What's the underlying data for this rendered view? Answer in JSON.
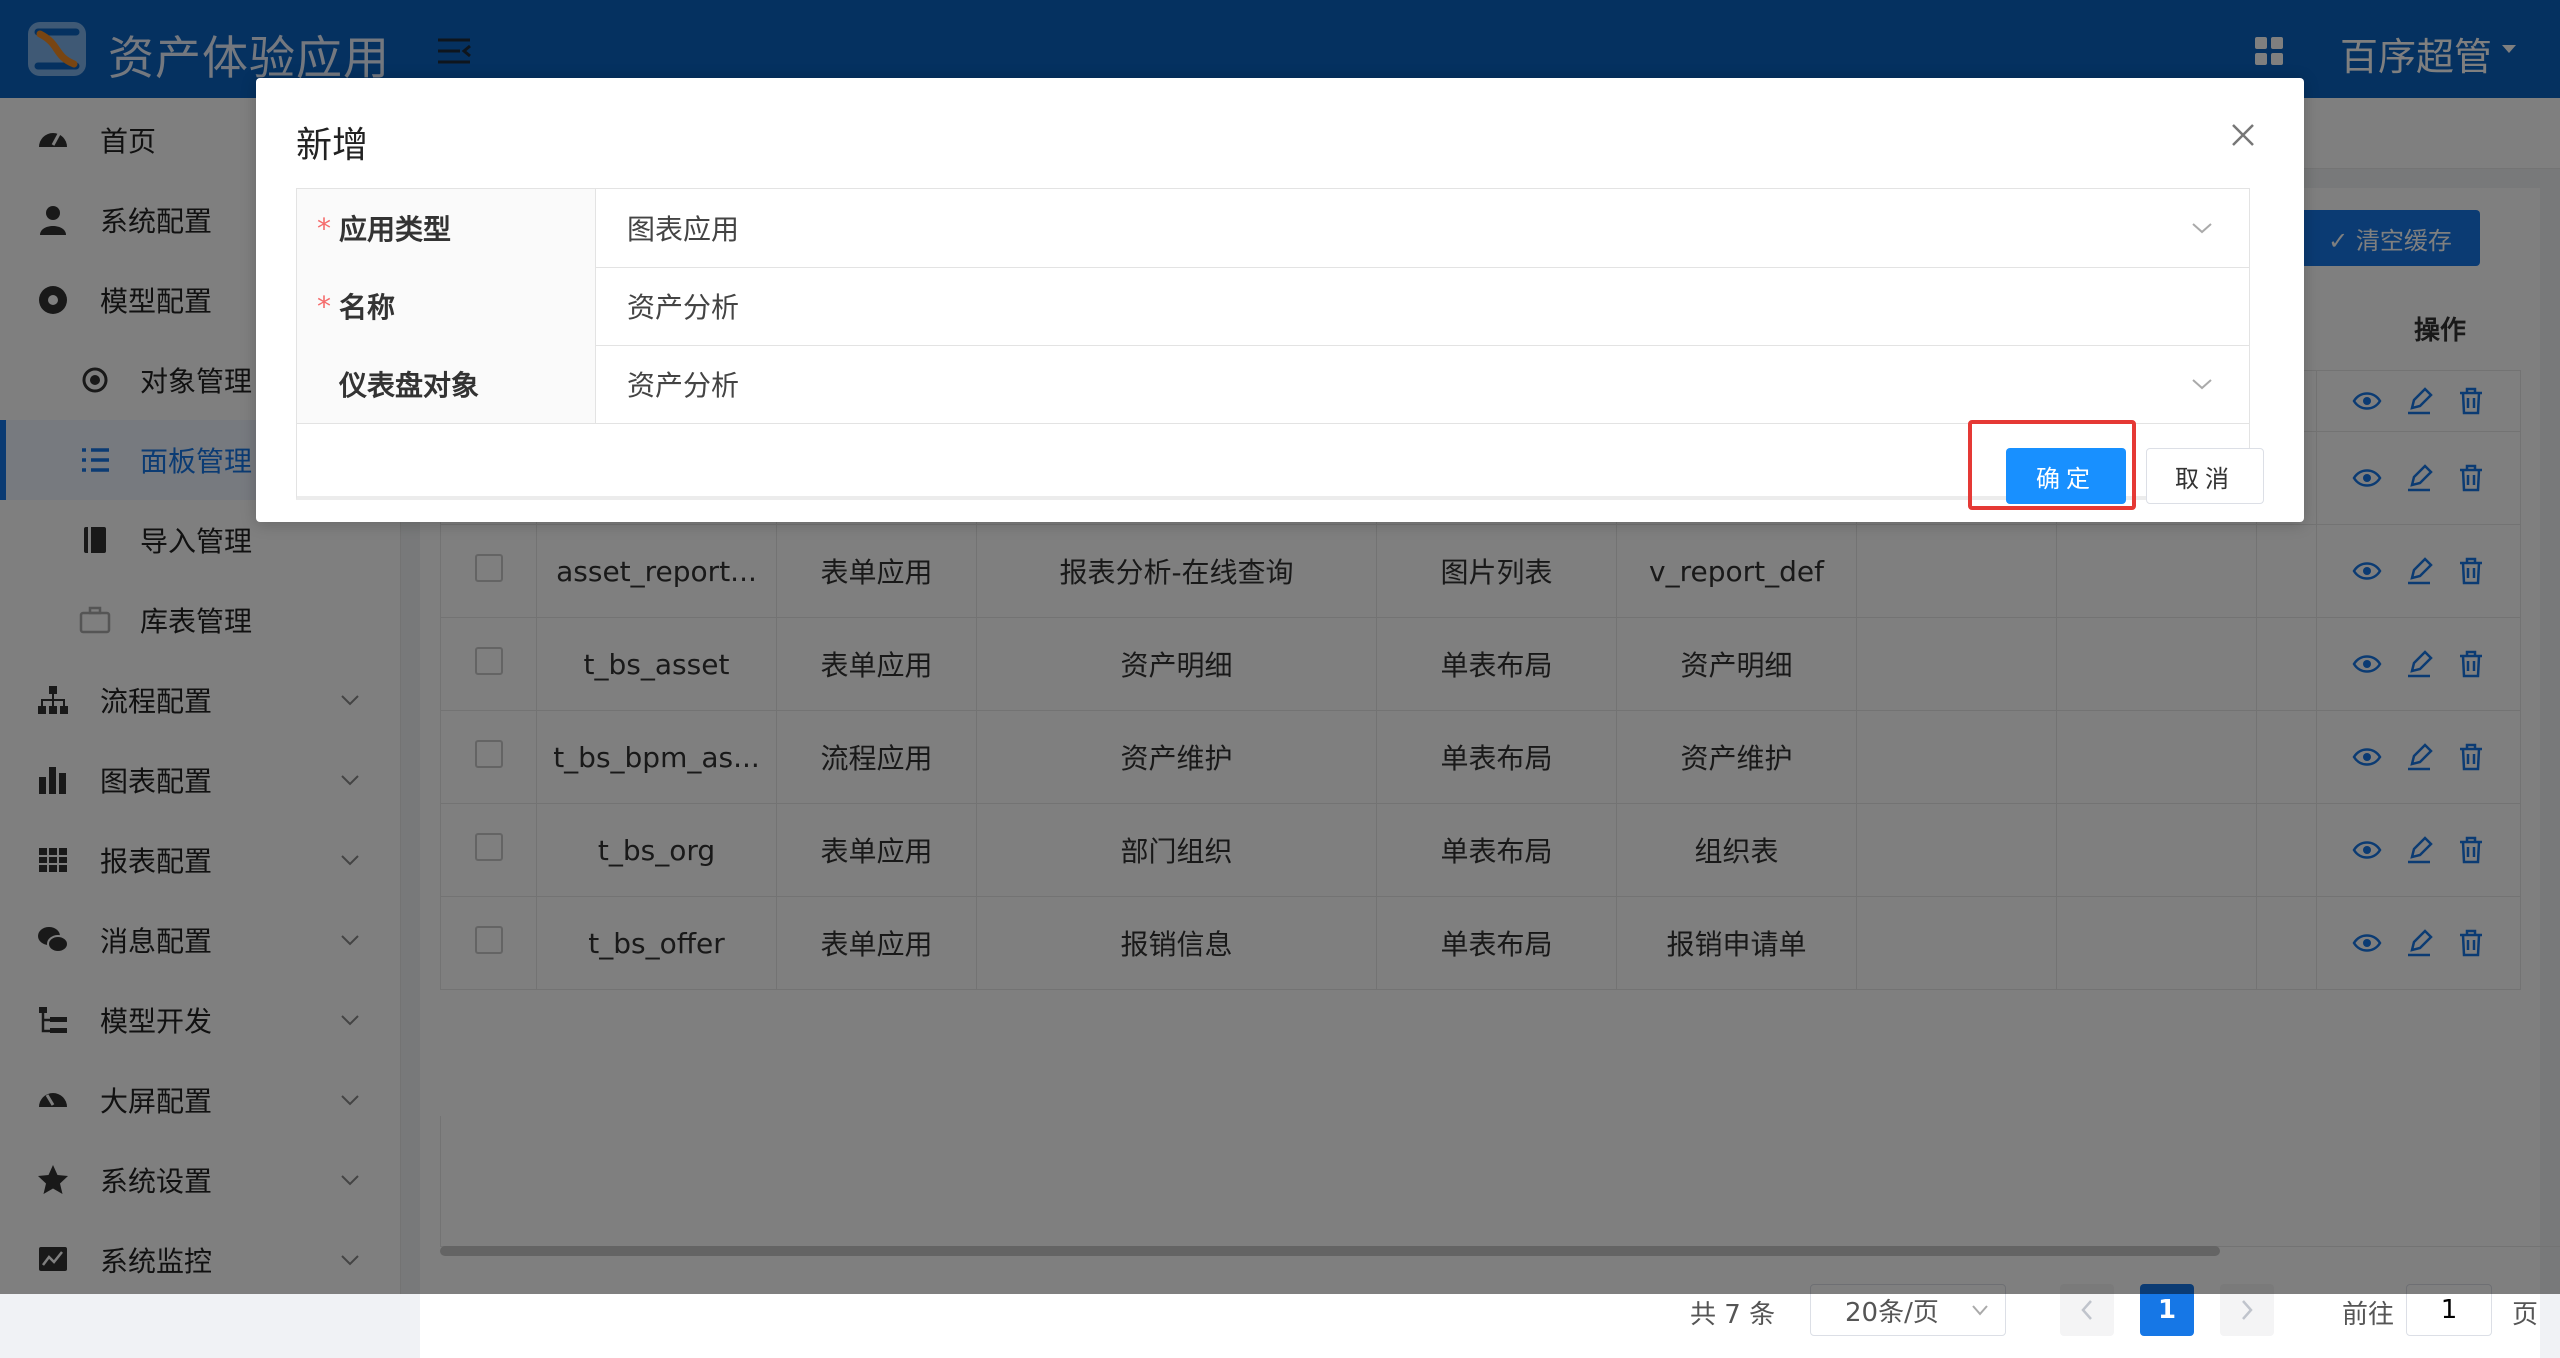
{
  "header": {
    "app_title": "资产体验应用",
    "user_name": "百序超管"
  },
  "sidebar": {
    "items": [
      {
        "label": "首页",
        "icon": "dashboard-icon"
      },
      {
        "label": "系统配置",
        "icon": "user-icon"
      },
      {
        "label": "模型配置",
        "icon": "model-icon"
      },
      {
        "label": "对象管理",
        "icon": "radio-icon"
      },
      {
        "label": "面板管理",
        "icon": "list-icon"
      },
      {
        "label": "导入管理",
        "icon": "book-icon"
      },
      {
        "label": "库表管理",
        "icon": "briefcase-icon"
      },
      {
        "label": "流程配置",
        "icon": "flow-icon"
      },
      {
        "label": "图表配置",
        "icon": "bar-chart-icon"
      },
      {
        "label": "报表配置",
        "icon": "table-icon"
      },
      {
        "label": "消息配置",
        "icon": "wechat-icon"
      },
      {
        "label": "模型开发",
        "icon": "tree-icon"
      },
      {
        "label": "大屏配置",
        "icon": "gauge-icon"
      },
      {
        "label": "系统设置",
        "icon": "star-icon"
      },
      {
        "label": "系统监控",
        "icon": "monitor-icon"
      }
    ]
  },
  "toolbar": {
    "clear_cache": "清空缓存"
  },
  "table": {
    "ops_header": "操作",
    "rows": [
      {
        "name": "asset_report...",
        "type": "表单应用",
        "title": "报表分析-在线查询",
        "layout": "图片列表",
        "object": "v_report_def"
      },
      {
        "name": "t_bs_asset",
        "type": "表单应用",
        "title": "资产明细",
        "layout": "单表布局",
        "object": "资产明细"
      },
      {
        "name": "t_bs_bpm_as...",
        "type": "流程应用",
        "title": "资产维护",
        "layout": "单表布局",
        "object": "资产维护"
      },
      {
        "name": "t_bs_org",
        "type": "表单应用",
        "title": "部门组织",
        "layout": "单表布局",
        "object": "组织表"
      },
      {
        "name": "t_bs_offer",
        "type": "表单应用",
        "title": "报销信息",
        "layout": "单表布局",
        "object": "报销申请单"
      }
    ]
  },
  "pagination": {
    "total": "共 7 条",
    "page_size": "20条/页",
    "current": "1",
    "goto_label": "前往",
    "goto_value": "1",
    "page_suffix": "页"
  },
  "dialog": {
    "title": "新增",
    "fields": [
      {
        "label": "应用类型",
        "value": "图表应用",
        "required": "*"
      },
      {
        "label": "名称",
        "value": "资产分析",
        "required": "*"
      },
      {
        "label": "仪表盘对象",
        "value": "资产分析",
        "required": ""
      }
    ],
    "ok_label": "确定",
    "cancel_label": "取消"
  },
  "colors": {
    "header_bg": "#0b63c1",
    "primary": "#1890ff",
    "highlight": "#e53935"
  }
}
